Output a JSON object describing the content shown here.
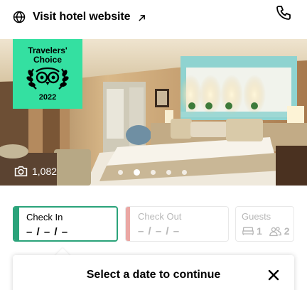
{
  "header": {
    "website_link": "Visit hotel website",
    "website_icon": "globe-icon",
    "external_icon": "external-arrow-icon",
    "phone_icon": "phone-icon"
  },
  "gallery": {
    "badge": {
      "line1": "Travelers'",
      "line2": "Choice",
      "year": "2022",
      "color": "#34e0a1"
    },
    "photo_count": "1,082",
    "camera_icon": "camera-icon",
    "dots": 5,
    "active_dot": 1
  },
  "dates": {
    "check_in": {
      "label": "Check In",
      "value": "– / – / –",
      "accent": "#2aa37a"
    },
    "check_out": {
      "label": "Check Out",
      "value": "– / – / –",
      "accent": "#eba7a4"
    },
    "guests": {
      "label": "Guests",
      "rooms": "1",
      "adults": "2"
    }
  },
  "popover": {
    "message": "Select a date to continue",
    "close_icon": "close-icon"
  }
}
